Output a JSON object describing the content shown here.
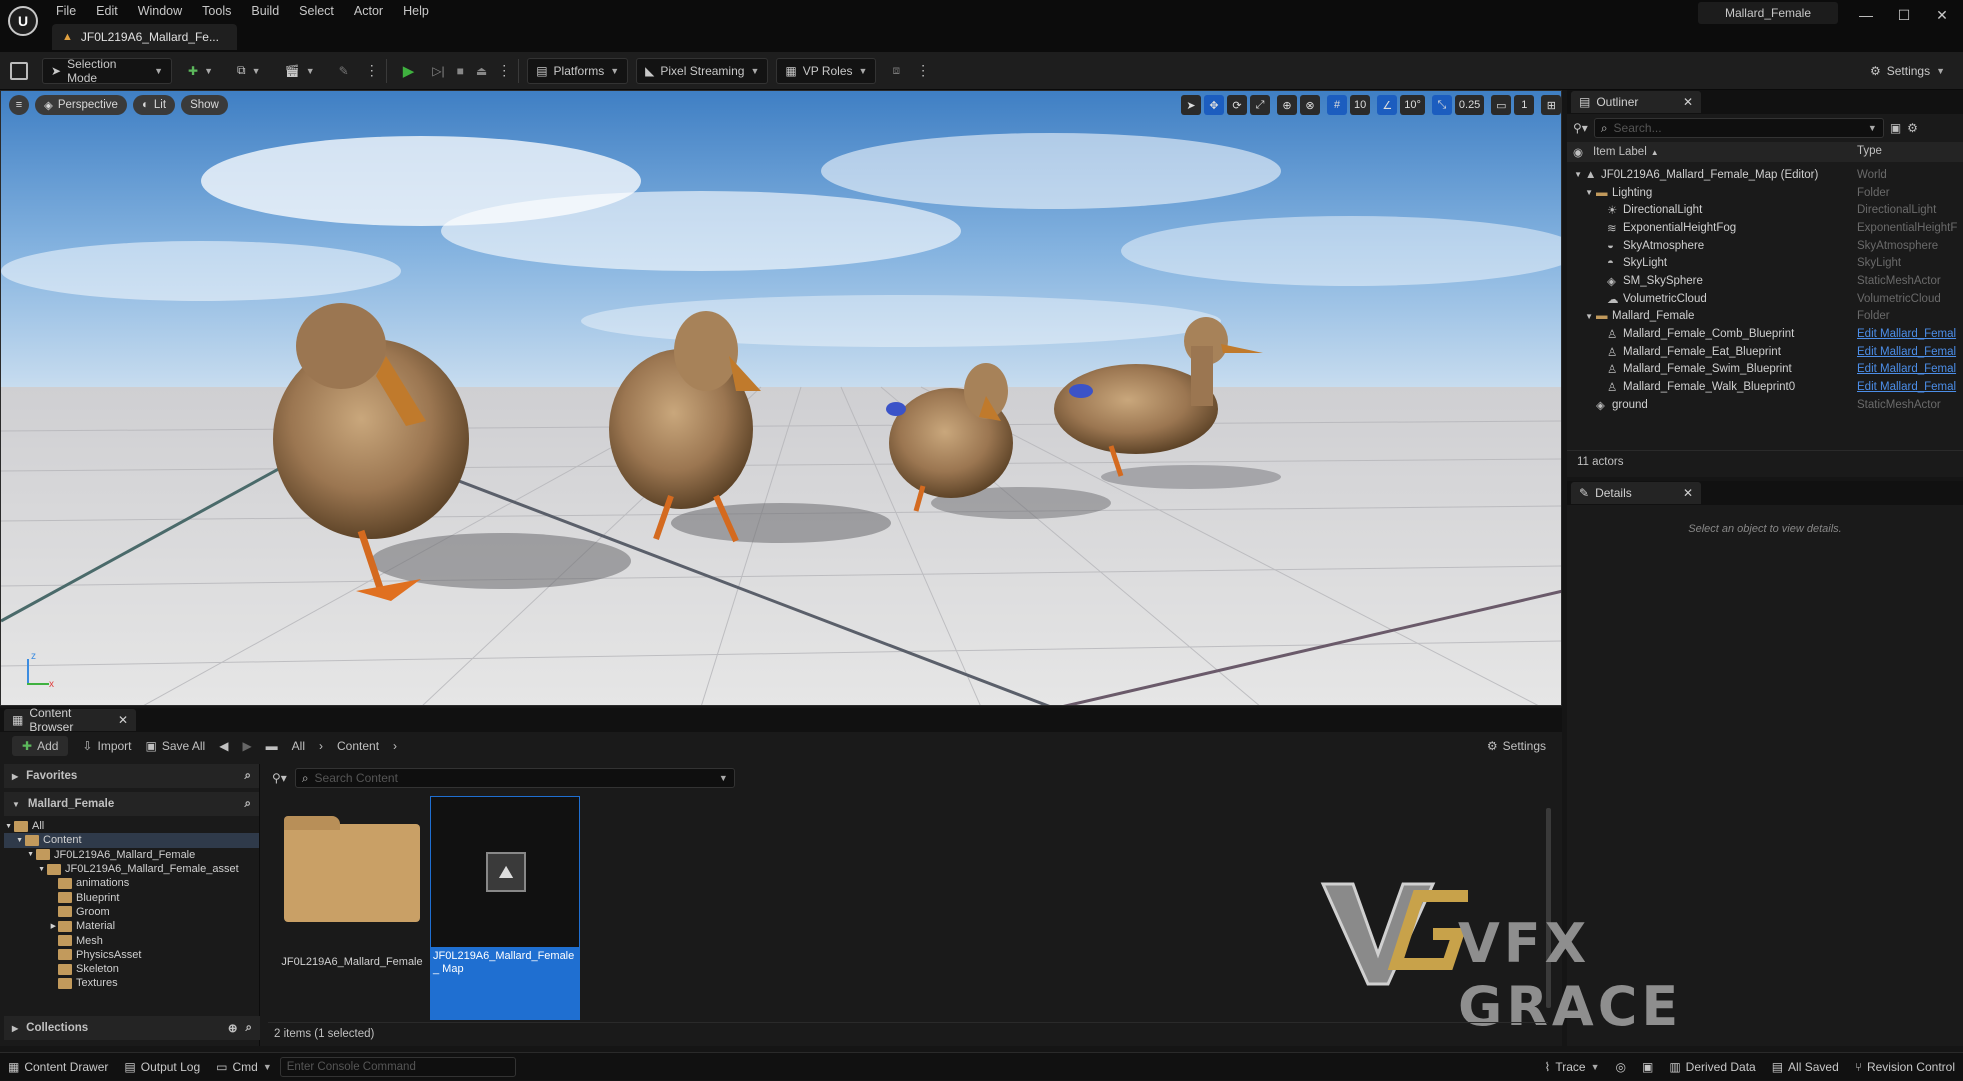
{
  "menu": [
    "File",
    "Edit",
    "Window",
    "Tools",
    "Build",
    "Select",
    "Actor",
    "Help"
  ],
  "level_tab": "JF0L219A6_Mallard_Fe...",
  "project_name": "Mallard_Female",
  "toolbar": {
    "selection_mode": "Selection Mode",
    "platforms": "Platforms",
    "pixel_streaming": "Pixel Streaming",
    "vp_roles": "VP Roles",
    "settings": "Settings"
  },
  "viewport": {
    "perspective": "Perspective",
    "lit": "Lit",
    "show": "Show",
    "grid_snap": "10",
    "rot_snap": "10°",
    "scale_snap": "0.25",
    "camera_speed": "1",
    "axis_z": "z",
    "axis_x": "x"
  },
  "outliner": {
    "tab": "Outliner",
    "search_placeholder": "Search...",
    "col_label": "Item Label",
    "col_type": "Type",
    "rows": [
      {
        "label": "JF0L219A6_Mallard_Female_Map (Editor)",
        "type": "World",
        "indent": 0,
        "arrow": "▼",
        "icon": "level-icon",
        "link": false
      },
      {
        "label": "Lighting",
        "type": "Folder",
        "indent": 1,
        "arrow": "▼",
        "icon": "folder-icon",
        "link": false
      },
      {
        "label": "DirectionalLight",
        "type": "DirectionalLight",
        "indent": 2,
        "arrow": "",
        "icon": "sun-icon",
        "link": false
      },
      {
        "label": "ExponentialHeightFog",
        "type": "ExponentialHeightF",
        "indent": 2,
        "arrow": "",
        "icon": "fog-icon",
        "link": false
      },
      {
        "label": "SkyAtmosphere",
        "type": "SkyAtmosphere",
        "indent": 2,
        "arrow": "",
        "icon": "atmosphere-icon",
        "link": false
      },
      {
        "label": "SkyLight",
        "type": "SkyLight",
        "indent": 2,
        "arrow": "",
        "icon": "skylight-icon",
        "link": false
      },
      {
        "label": "SM_SkySphere",
        "type": "StaticMeshActor",
        "indent": 2,
        "arrow": "",
        "icon": "mesh-icon",
        "link": false
      },
      {
        "label": "VolumetricCloud",
        "type": "VolumetricCloud",
        "indent": 2,
        "arrow": "",
        "icon": "cloud-icon",
        "link": false
      },
      {
        "label": "Mallard_Female",
        "type": "Folder",
        "indent": 1,
        "arrow": "▼",
        "icon": "folder-icon",
        "link": false
      },
      {
        "label": "Mallard_Female_Comb_Blueprint",
        "type": "Edit Mallard_Femal",
        "indent": 2,
        "arrow": "",
        "icon": "pawn-icon",
        "link": true
      },
      {
        "label": "Mallard_Female_Eat_Blueprint",
        "type": "Edit Mallard_Femal",
        "indent": 2,
        "arrow": "",
        "icon": "pawn-icon",
        "link": true
      },
      {
        "label": "Mallard_Female_Swim_Blueprint",
        "type": "Edit Mallard_Femal",
        "indent": 2,
        "arrow": "",
        "icon": "pawn-icon",
        "link": true
      },
      {
        "label": "Mallard_Female_Walk_Blueprint0",
        "type": "Edit Mallard_Femal",
        "indent": 2,
        "arrow": "",
        "icon": "pawn-icon",
        "link": true
      },
      {
        "label": "ground",
        "type": "StaticMeshActor",
        "indent": 1,
        "arrow": "",
        "icon": "mesh-icon",
        "link": false
      }
    ],
    "actor_count": "11 actors"
  },
  "details": {
    "tab": "Details",
    "empty_text": "Select an object to view details."
  },
  "content_browser": {
    "tab": "Content Browser",
    "add": "Add",
    "import": "Import",
    "save_all": "Save All",
    "path": [
      "All",
      "Content"
    ],
    "settings": "Settings",
    "search_placeholder": "Search Content",
    "favorites": "Favorites",
    "project": "Mallard_Female",
    "tree": [
      {
        "label": "All",
        "indent": 0,
        "arrow": "▼",
        "selected": false
      },
      {
        "label": "Content",
        "indent": 1,
        "arrow": "▼",
        "selected": true
      },
      {
        "label": "JF0L219A6_Mallard_Female",
        "indent": 2,
        "arrow": "▼",
        "selected": false
      },
      {
        "label": "JF0L219A6_Mallard_Female_asset",
        "indent": 3,
        "arrow": "▼",
        "selected": false
      },
      {
        "label": "animations",
        "indent": 4,
        "arrow": "",
        "selected": false
      },
      {
        "label": "Blueprint",
        "indent": 4,
        "arrow": "",
        "selected": false
      },
      {
        "label": "Groom",
        "indent": 4,
        "arrow": "",
        "selected": false
      },
      {
        "label": "Material",
        "indent": 4,
        "arrow": "▶",
        "selected": false
      },
      {
        "label": "Mesh",
        "indent": 4,
        "arrow": "",
        "selected": false
      },
      {
        "label": "PhysicsAsset",
        "indent": 4,
        "arrow": "",
        "selected": false
      },
      {
        "label": "Skeleton",
        "indent": 4,
        "arrow": "",
        "selected": false
      },
      {
        "label": "Textures",
        "indent": 4,
        "arrow": "",
        "selected": false
      }
    ],
    "collections": "Collections",
    "assets": [
      {
        "label": "JF0L219A6_Mallard_Female",
        "kind": "folder"
      },
      {
        "label": "JF0L219A6_Mallard_Female_ Map",
        "kind": "map"
      }
    ],
    "status": "2 items (1 selected)",
    "watermark": "VFX GRACE"
  },
  "statusbar": {
    "content_drawer": "Content Drawer",
    "output_log": "Output Log",
    "cmd": "Cmd",
    "console_placeholder": "Enter Console Command",
    "trace": "Trace",
    "derived_data": "Derived Data",
    "all_saved": "All Saved",
    "revision_control": "Revision Control"
  },
  "colors": {
    "accent": "#1f6fd1",
    "play": "#3fb13f",
    "folder": "#c29a5c",
    "link": "#4c8ee8"
  }
}
